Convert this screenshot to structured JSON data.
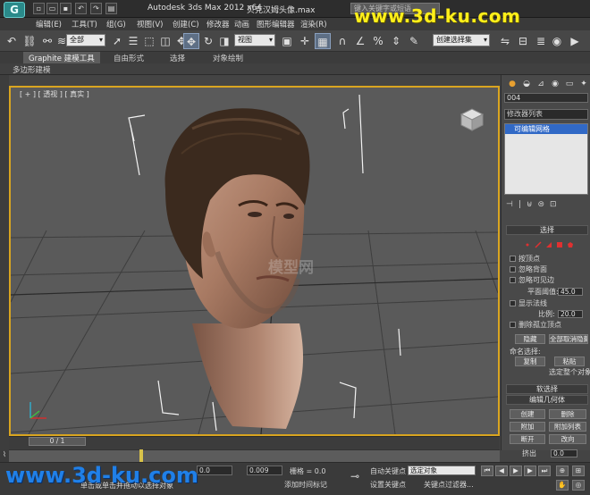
{
  "titlebar": {
    "app_title": "Autodesk 3ds Max  2012 x64",
    "file_title": "贝克汉姆头像.max",
    "search_placeholder": "键入关键字或短语"
  },
  "menu": [
    "编辑(E)",
    "工具(T)",
    "组(G)",
    "视图(V)",
    "创建(C)",
    "修改器",
    "动画",
    "图形编辑器",
    "渲染(R)"
  ],
  "toolbar": {
    "selection_filter": "全部",
    "reference_coord": "视图",
    "named_selection": "创建选择集"
  },
  "ribbon": {
    "tabs": [
      "Graphite 建模工具",
      "自由形式",
      "选择",
      "对象绘制"
    ],
    "sub_label": "多边形建模"
  },
  "viewport": {
    "label": "[ + ] [ 透视 ] [ 真实 ]",
    "center_watermark": "模型网"
  },
  "command_panel": {
    "object_name": "004",
    "modifier_list": "修改器列表",
    "stack_item": "可编辑网格",
    "selection_rollout": {
      "title": "选择",
      "options": [
        "按顶点",
        "忽略背面",
        "忽略可见边"
      ],
      "planar_threshold_label": "平面阈值:",
      "planar_threshold_value": "45.0",
      "show_normals": "显示法线",
      "scale_label": "比例:",
      "scale_value": "20.0",
      "delete_isolated": "删除孤立顶点",
      "hide_button": "隐藏",
      "unhide_all_button": "全部取消隐藏",
      "named_selection_label": "命名选择:",
      "copy_button": "复制",
      "paste_button": "粘贴",
      "selected_text": "选定整个对象"
    },
    "soft_selection_title": "软选择",
    "edit_geometry": {
      "title": "编辑几何体",
      "buttons": [
        "创建",
        "删除",
        "附加",
        "附加列表",
        "断开",
        "改向"
      ],
      "extrude_label": "挤出",
      "extrude_value": "0.0"
    }
  },
  "timeline": {
    "frame": "0 / 1"
  },
  "status": {
    "x_value": "0.0",
    "z_value": "0.009",
    "grid_label": "栅格 = 0.0",
    "auto_key": "自动关键点",
    "set_key": "设置关键点",
    "key_filter_dropdown": "选定对象",
    "key_filters": "关键点过滤器...",
    "add_time_tag": "添加时间标记",
    "prompt": "单击或单击并拖动以选择对象"
  },
  "watermarks": {
    "top": "www.3d-ku.com",
    "bottom": "www.3d-ku.com"
  }
}
